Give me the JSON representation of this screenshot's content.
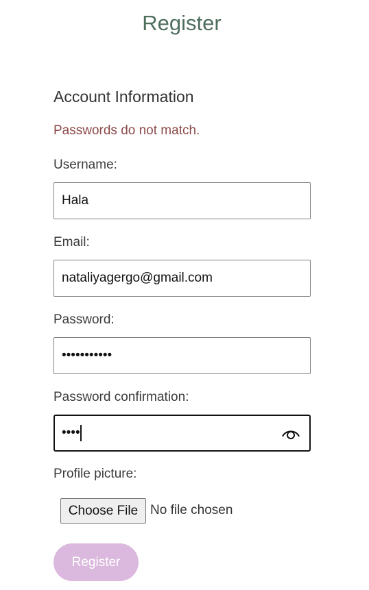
{
  "page": {
    "title": "Register"
  },
  "form": {
    "section_title": "Account Information",
    "error": "Passwords do not match.",
    "username": {
      "label": "Username:",
      "value": "Hala"
    },
    "email": {
      "label": "Email:",
      "value": "nataliyagergo@gmail.com"
    },
    "password": {
      "label": "Password:",
      "masked": "•••••••••••",
      "length": 11
    },
    "password_confirmation": {
      "label": "Password confirmation:",
      "masked": "••••",
      "length": 4,
      "focused": true,
      "icon": "eye-icon"
    },
    "profile_picture": {
      "label": "Profile picture:",
      "button": "Choose File",
      "status": "No file chosen"
    },
    "submit": {
      "label": "Register"
    }
  },
  "colors": {
    "title": "#4e6e5d",
    "error": "#8c4a4a",
    "submit_bg": "#dbb8dd"
  }
}
